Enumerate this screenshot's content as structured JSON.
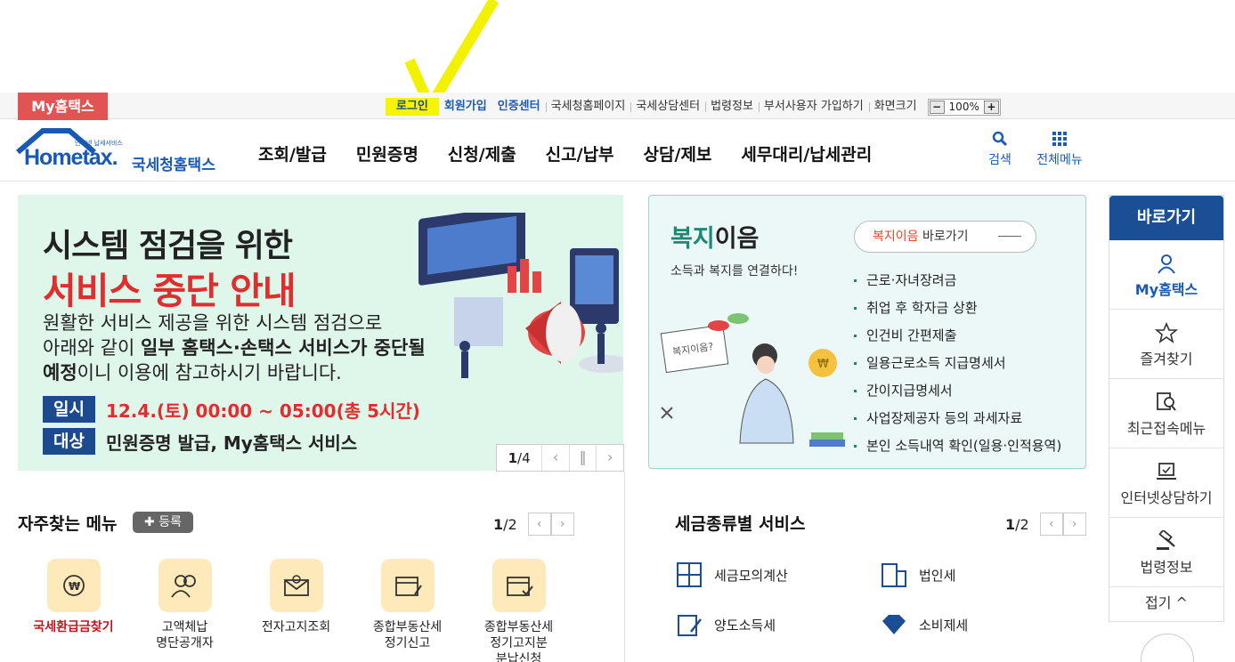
{
  "topbar": {
    "my_hometax": "My홈택스",
    "links": [
      "로그인",
      "회원가입",
      "인증센터",
      "국세청홈페이지",
      "국세상담센터",
      "법령정보",
      "부서사용자 가입하기",
      "화면크기"
    ],
    "zoom": "100%",
    "zoom_minus": "−",
    "zoom_plus": "+"
  },
  "header": {
    "logo_small": "인터넷 납세서비스",
    "logo_brand": "Hometax.",
    "logo_kor": "국세청홈택스",
    "nav": [
      "조회/발급",
      "민원증명",
      "신청/제출",
      "신고/납부",
      "상담/제보",
      "세무대리/납세관리"
    ],
    "search": "검색",
    "all_menu": "전체메뉴"
  },
  "banner": {
    "title1": "시스템 점검을 위한",
    "title2": "서비스 중단 안내",
    "desc_line1": "원활한 서비스 제공을 위한 시스템 점검으로",
    "desc_line2_a": "아래와 같이 ",
    "desc_line2_b": "일부 홈택스·손택스 서비스가 중단될",
    "desc_line3_a": "예정",
    "desc_line3_b": "이니 이용에 참고하시기 바랍니다.",
    "date_tag": "일시",
    "date_value": "12.4.(토) 00:00 ~ 05:00(총 5시간)",
    "target_tag": "대상",
    "target_value": "민원증명 발급, My홈택스 서비스",
    "pager_current": "1",
    "pager_total": "/4"
  },
  "welfare": {
    "title_hl": "복지",
    "title_rest": "이음",
    "subtitle": "소득과 복지를 연결하다!",
    "go_red": "복지이음",
    "go_rest": " 바로가기",
    "illust_sign": "복지이음?",
    "items": [
      "근로·자녀장려금",
      "취업 후 학자금 상환",
      "인건비 간편제출",
      "일용근로소득 지급명세서",
      "간이지급명세서",
      "사업장제공자 등의 과세자료",
      "본인 소득내역 확인(일용·인적용역)"
    ]
  },
  "quick": {
    "head": "바로가기",
    "items": [
      "My홈택스",
      "즐겨찾기",
      "최근접속메뉴",
      "인터넷상담하기",
      "법령정보"
    ],
    "fold": "접기 ^"
  },
  "freq": {
    "title": "자주찾는 메뉴",
    "register": "등록",
    "pager_current": "1",
    "pager_total": "/2",
    "items": [
      {
        "l1": "국세환급금찾기",
        "l2": ""
      },
      {
        "l1": "고액체납",
        "l2": "명단공개자"
      },
      {
        "l1": "전자고지조회",
        "l2": ""
      },
      {
        "l1": "종합부동산세",
        "l2": "정기신고"
      },
      {
        "l1": "종합부동산세",
        "l2": "정기고지분",
        "l3": "분납신청"
      }
    ]
  },
  "tax": {
    "title": "세금종류별 서비스",
    "pager_current": "1",
    "pager_total": "/2",
    "items": [
      "세금모의계산",
      "법인세",
      "양도소득세",
      "소비제세"
    ]
  }
}
